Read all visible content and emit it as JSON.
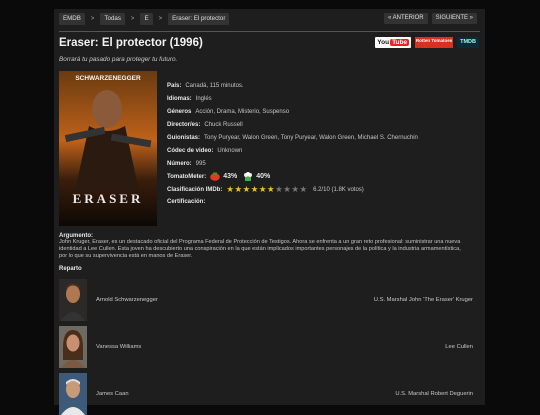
{
  "breadcrumb": [
    "EMDB",
    "Todas",
    "E",
    "Eraser: El protector"
  ],
  "breadcrumb_separator": ">",
  "pager": {
    "prev": "« ANTERIOR",
    "next": "SIGUIENTE »"
  },
  "movie": {
    "title": "Eraser: El protector (1996)",
    "tagline": "Borrará tu pasado para proteger tu futuro.",
    "poster": {
      "top_name": "SCHWARZENEGGER",
      "title_text": "ERASER"
    }
  },
  "badges": {
    "youtube_you": "You",
    "youtube_tube": "Tube",
    "rt": "Rotten Tomatoes",
    "tmdb": "TMDB"
  },
  "details": [
    {
      "label": "País:",
      "value": "Canadá, 115 minutos."
    },
    {
      "label": "Idiomas:",
      "value": "Inglés"
    },
    {
      "label": "Géneros",
      "value": "Acción, Drama, Misterio, Suspenso"
    },
    {
      "label": "Director/es:",
      "value": "Chuck Russell"
    },
    {
      "label": "Guionistas:",
      "value": "Tony Puryear, Walon Green, Tony Puryear, Walon Green, Michael S. Chernuchin"
    },
    {
      "label": "Códec de video:",
      "value": "Unknown"
    },
    {
      "label": "Número:",
      "value": "995"
    }
  ],
  "tomatometer": {
    "label": "TomatoMeter:",
    "critics": "43%",
    "audience": "40%"
  },
  "imdb": {
    "label": "Clasificación IMDb:",
    "rating_value": 6.2,
    "stars_total": 10,
    "text": "6.2/10 (1.8K votos)"
  },
  "certification": {
    "label": "Certificación:",
    "value": ""
  },
  "argument": {
    "label": "Argumento:",
    "text": "John Kruger, Eraser, es un destacado oficial del Programa Federal de Protección de Testigos. Ahora se enfrenta a un gran reto profesional: suministrar una nueva identidad a Lee Cullen. Esta joven ha descubierto una conspiración en la que están implicados importantes personajes de la política y la industria armamentística, por lo que su supervivencia está en manos de Eraser."
  },
  "cast": {
    "label": "Reparto",
    "members": [
      {
        "name": "Arnold Schwarzenegger",
        "role": "U.S. Marshal John 'The Eraser' Kruger"
      },
      {
        "name": "Vanessa Williams",
        "role": "Lee Cullen"
      },
      {
        "name": "James Caan",
        "role": "U.S. Marshal Robert Deguerin"
      }
    ]
  },
  "colors": {
    "background": "#0a0a0a",
    "panel": "#1e1e1e",
    "star_on": "#e8c320"
  }
}
